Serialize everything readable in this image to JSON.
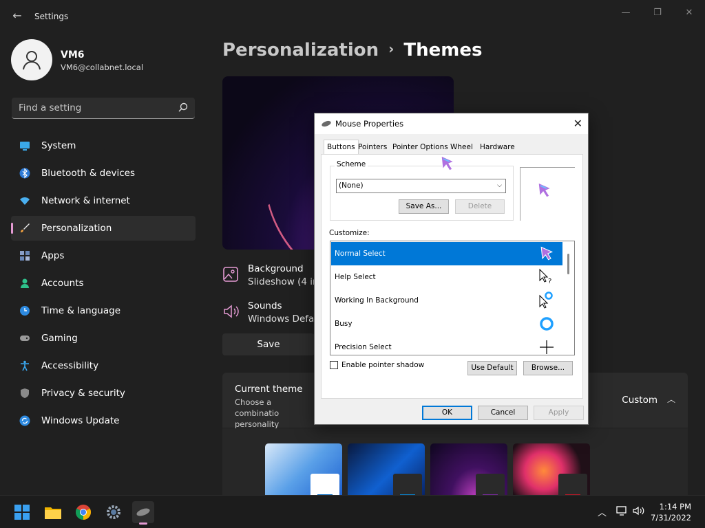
{
  "app": {
    "title": "Settings"
  },
  "user": {
    "name": "VM6",
    "email": "VM6@collabnet.local"
  },
  "search": {
    "placeholder": "Find a setting"
  },
  "nav": [
    {
      "label": "System",
      "icon": "monitor-icon"
    },
    {
      "label": "Bluetooth & devices",
      "icon": "bluetooth-icon"
    },
    {
      "label": "Network & internet",
      "icon": "wifi-icon"
    },
    {
      "label": "Personalization",
      "icon": "brush-icon",
      "active": true
    },
    {
      "label": "Apps",
      "icon": "apps-icon"
    },
    {
      "label": "Accounts",
      "icon": "person-icon"
    },
    {
      "label": "Time & language",
      "icon": "clock-globe-icon"
    },
    {
      "label": "Gaming",
      "icon": "gamepad-icon"
    },
    {
      "label": "Accessibility",
      "icon": "accessibility-icon"
    },
    {
      "label": "Privacy & security",
      "icon": "shield-icon"
    },
    {
      "label": "Windows Update",
      "icon": "update-icon"
    }
  ],
  "breadcrumb": {
    "parent": "Personalization",
    "current": "Themes"
  },
  "theme_rows": {
    "background": {
      "title": "Background",
      "value": "Slideshow (4 im"
    },
    "sounds": {
      "title": "Sounds",
      "value": "Windows Defau"
    }
  },
  "save_label": "Save",
  "current_theme": {
    "title": "Current theme",
    "desc": "Choose a combinatio personality",
    "desc1": "Choose a combinatio",
    "desc2": "personality",
    "value": "Custom"
  },
  "dialog": {
    "title": "Mouse Properties",
    "tabs": [
      "Buttons",
      "Pointers",
      "Pointer Options",
      "Wheel",
      "Hardware"
    ],
    "scheme_label": "Scheme",
    "scheme_value": "(None)",
    "save_as": "Save As...",
    "delete": "Delete",
    "customize_label": "Customize:",
    "pointers": [
      "Normal Select",
      "Help Select",
      "Working In Background",
      "Busy",
      "Precision Select"
    ],
    "enable_shadow": "Enable pointer shadow",
    "use_default": "Use Default",
    "browse": "Browse...",
    "ok": "OK",
    "cancel": "Cancel",
    "apply": "Apply"
  },
  "clock": {
    "time": "1:14 PM",
    "date": "7/31/2022"
  },
  "colors": {
    "accent": "#0078d7",
    "nav_indicator": "#e49ad3",
    "bg": "#202020"
  }
}
